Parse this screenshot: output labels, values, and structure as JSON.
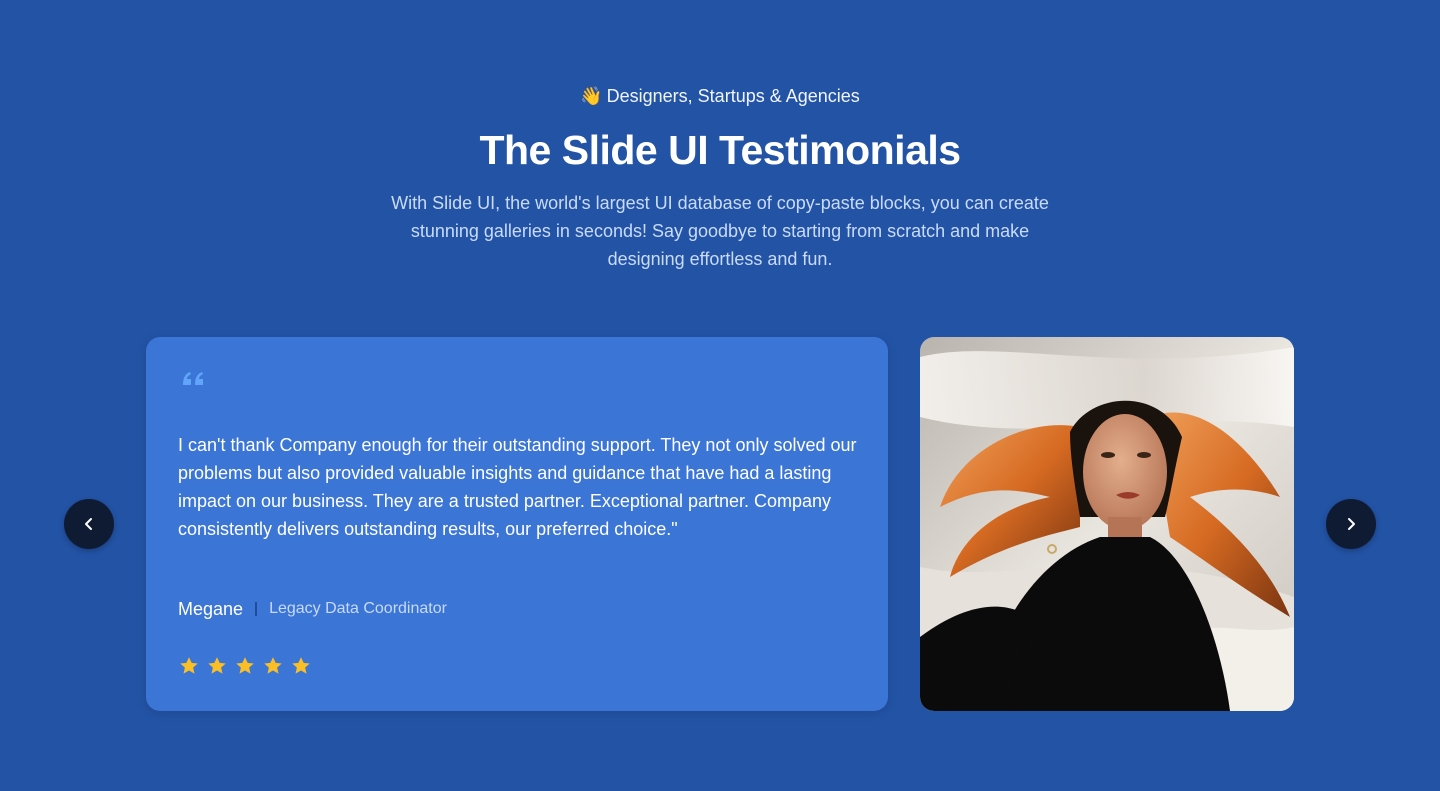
{
  "header": {
    "eyebrow_emoji": "👋",
    "eyebrow_text": "Designers, Startups & Agencies",
    "title": "The Slide UI Testimonials",
    "subtitle": "With Slide UI, the world's largest UI database of copy-paste blocks, you can create stunning galleries in seconds! Say goodbye to starting from scratch and make designing effortless and fun."
  },
  "testimonial": {
    "quote_icon": "quote-icon",
    "quote": "I can't thank Company enough for their outstanding support. They not only solved our problems but also provided valuable insights and guidance that have had a lasting impact on our business. They are a trusted partner. Exceptional partner. Company consistently delivers outstanding results, our preferred choice.\"",
    "author_name": "Megane",
    "author_role": "Legacy Data Coordinator",
    "rating": 5,
    "rating_max": 5,
    "star_color": "#fbbf24",
    "photo_alt": "Portrait of a woman with flowing orange-streaked hair and white fabric"
  },
  "navigation": {
    "prev_icon": "chevron-left-icon",
    "next_icon": "chevron-right-icon"
  },
  "colors": {
    "background": "#2353a5",
    "card": "#3b75d6",
    "button": "#0f1b33",
    "quote_icon": "#60a5fa"
  }
}
